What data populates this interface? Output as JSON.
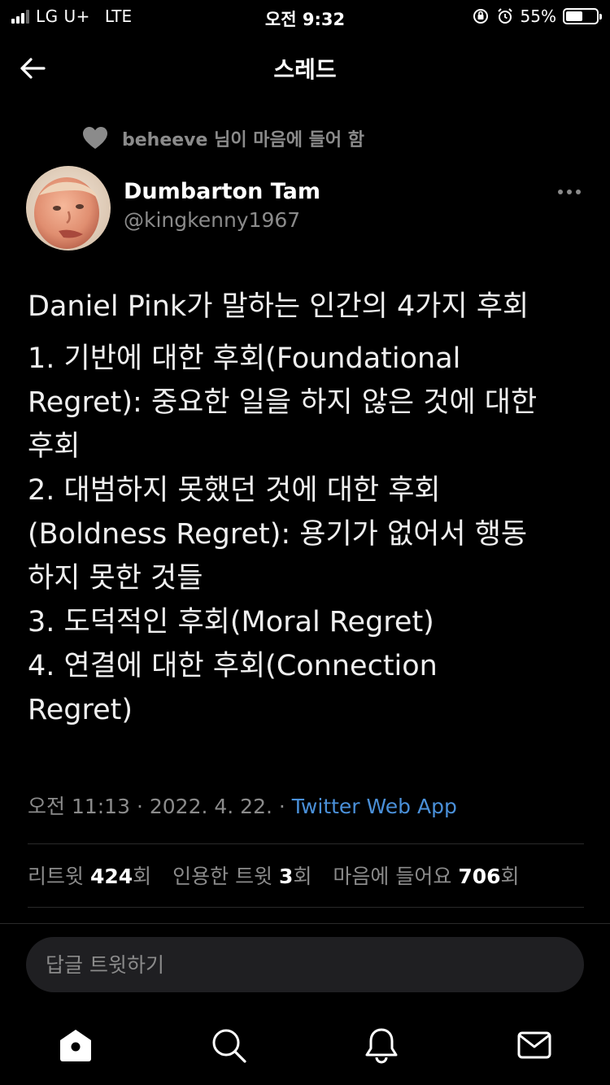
{
  "status_bar": {
    "carrier": "LG U+",
    "network": "LTE",
    "time": "오전 9:32",
    "battery": "55%",
    "battery_level": 0.55
  },
  "header": {
    "title": "스레드",
    "back_icon": "arrow-left-icon"
  },
  "social_context": {
    "text": "beheeve 님이 마음에 들어 함",
    "icon": "heart-icon"
  },
  "author": {
    "display_name": "Dumbarton Tam",
    "handle": "@kingkenny1967",
    "more_icon": "more-horizontal-icon"
  },
  "tweet": {
    "lines": [
      "Daniel Pink가 말하는 인간의 4가지 후회",
      "1. 기반에 대한 후회(Foundational",
      "Regret): 중요한 일을 하지 않은 것에 대한",
      "후회",
      "2. 대범하지 못했던 것에 대한 후회",
      "(Boldness Regret): 용기가 없어서 행동",
      "하지 못한 것들",
      "3. 도덕적인 후회(Moral Regret)",
      "4. 연결에 대한 후회(Connection",
      "Regret)"
    ],
    "time": "오전 11:13",
    "date": "2022. 4. 22.",
    "separator": "·",
    "source": "Twitter Web App"
  },
  "stats": {
    "retweets_label": "리트윗",
    "retweets_count": "424",
    "retweets_suffix": "회",
    "quotes_label": "인용한 트윗",
    "quotes_count": "3",
    "quotes_suffix": "회",
    "likes_label": "마음에 들어요",
    "likes_count": "706",
    "likes_suffix": "회"
  },
  "reply": {
    "placeholder": "답글 트윗하기"
  },
  "tab_bar": {
    "icons": [
      "home-icon",
      "search-icon",
      "notifications-icon",
      "messages-icon"
    ]
  },
  "colors": {
    "background": "#000000",
    "link": "#4a90d9",
    "secondary_text": "#8b8b8b"
  }
}
